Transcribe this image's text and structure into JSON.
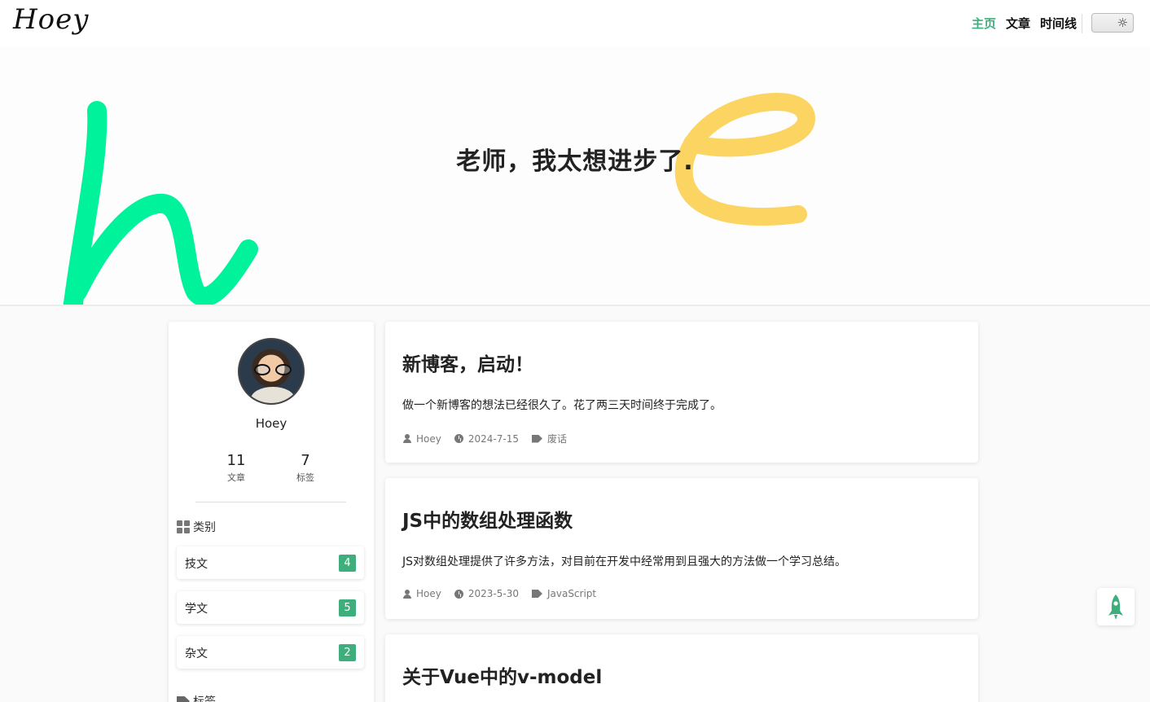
{
  "header": {
    "logo": "Hoey",
    "nav": [
      {
        "label": "主页",
        "active": true
      },
      {
        "label": "文章",
        "active": false
      },
      {
        "label": "时间线",
        "active": false
      }
    ],
    "theme_toggle_icon": "sun-icon"
  },
  "hero": {
    "slogan": "老师，我太想进步了.",
    "colors": {
      "h": "#00f29a",
      "e": "#fcd462"
    }
  },
  "sidebar": {
    "user_name": "Hoey",
    "stats": [
      {
        "value": "11",
        "label": "文章"
      },
      {
        "value": "7",
        "label": "标签"
      }
    ],
    "categories_title": "类别",
    "categories": [
      {
        "name": "技文",
        "count": "4"
      },
      {
        "name": "学文",
        "count": "5"
      },
      {
        "name": "杂文",
        "count": "2"
      }
    ],
    "tags_title": "标签"
  },
  "posts": [
    {
      "title": "新博客，启动！",
      "desc": "做一个新博客的想法已经很久了。花了两三天时间终于完成了。",
      "author": "Hoey",
      "date": "2024-7-15",
      "tag": "废话"
    },
    {
      "title": "JS中的数组处理函数",
      "desc": "JS对数组处理提供了许多方法，对目前在开发中经常用到且强大的方法做一个学习总结。",
      "author": "Hoey",
      "date": "2023-5-30",
      "tag": "JavaScript"
    },
    {
      "title": "关于Vue中的v-model",
      "desc": "",
      "author": "",
      "date": "",
      "tag": ""
    }
  ],
  "accent_color": "#3eaf7c",
  "back_to_top_icon": "rocket-icon"
}
